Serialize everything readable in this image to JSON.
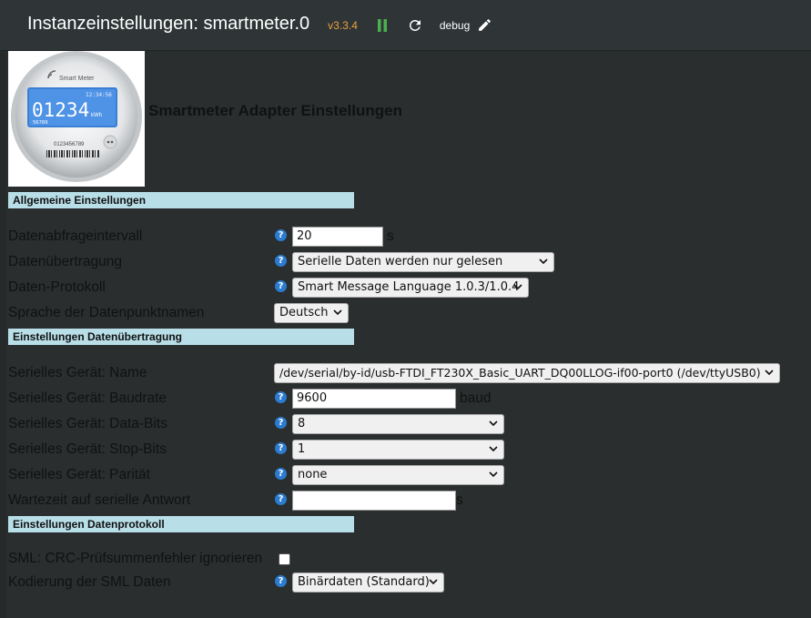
{
  "header": {
    "title": "Instanzeinstellungen: smartmeter.0",
    "version": "v3.3.4",
    "debug_label": "debug"
  },
  "meter_image": {
    "brand": "Smart Meter",
    "time": "12:34:56",
    "reading": "01234",
    "unit": "kWh",
    "small_number": "56789",
    "serial": "0123456789"
  },
  "page_heading": "Smartmeter Adapter Einstellungen",
  "sections": {
    "general": "Allgemeine Einstellungen",
    "transfer": "Einstellungen Datenübertragung",
    "protocol": "Einstellungen Datenprotokoll"
  },
  "fields": {
    "interval": {
      "label": "Datenabfrageintervall",
      "value": "20",
      "unit": "s"
    },
    "transfer": {
      "label": "Datenübertragung",
      "value": "Serielle Daten werden nur gelesen"
    },
    "protocol": {
      "label": "Daten-Protokoll",
      "value": "Smart Message Language 1.0.3/1.0.4"
    },
    "language": {
      "label": "Sprache der Datenpunktnamen",
      "value": "Deutsch"
    },
    "serial_name": {
      "label": "Serielles Gerät: Name",
      "value": "/dev/serial/by-id/usb-FTDI_FT230X_Basic_UART_DQ00LLOG-if00-port0 (/dev/ttyUSB0)"
    },
    "baudrate": {
      "label": "Serielles Gerät: Baudrate",
      "value": "9600",
      "unit": "baud"
    },
    "databits": {
      "label": "Serielles Gerät: Data-Bits",
      "value": "8"
    },
    "stopbits": {
      "label": "Serielles Gerät: Stop-Bits",
      "value": "1"
    },
    "parity": {
      "label": "Serielles Gerät: Parität",
      "value": "none"
    },
    "wait": {
      "label": "Wartezeit auf serielle Antwort",
      "value": "",
      "unit": "s"
    },
    "crc": {
      "label": "SML: CRC-Prüfsummenfehler ignorieren",
      "checked": false
    },
    "encoding": {
      "label": "Kodierung der SML Daten",
      "value": "Binärdaten (Standard)"
    }
  },
  "colors": {
    "background": "#2a2e2f",
    "topbar": "#2f3536",
    "section": "#b8dee8",
    "version": "#e6a23c",
    "pause_icon": "#4caf50",
    "help": "#2b7bd0"
  }
}
